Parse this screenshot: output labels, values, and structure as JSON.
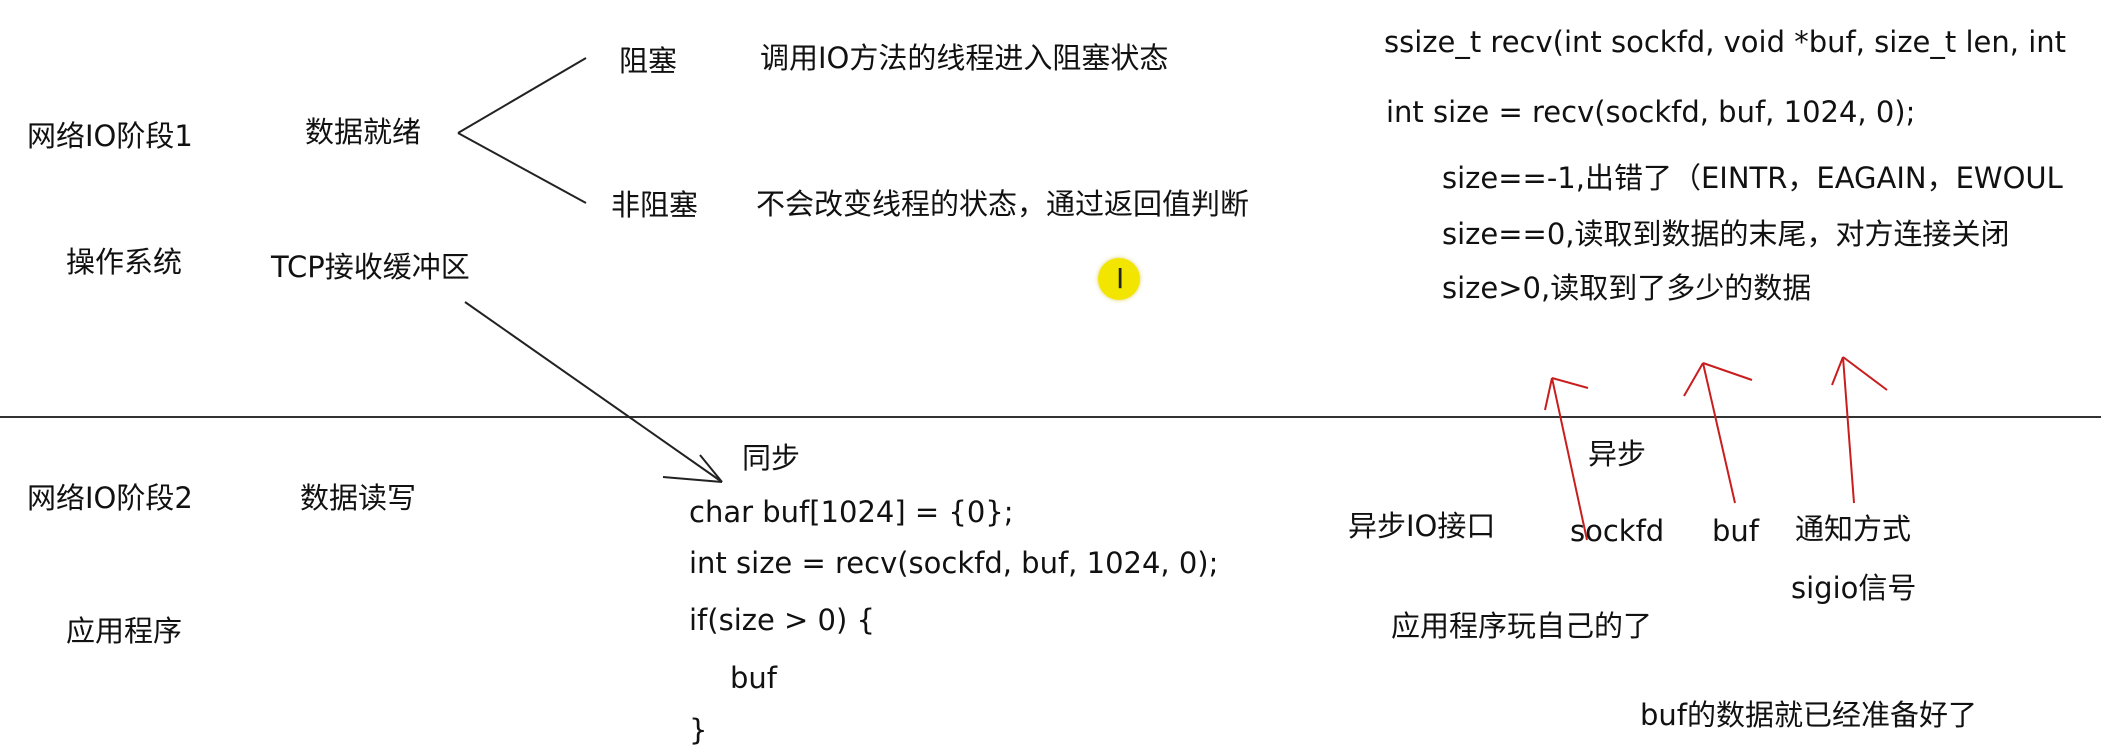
{
  "stage1": {
    "label": "网络IO阶段1",
    "sub_label": "操作系统",
    "data_ready": "数据就绪",
    "tcp_buffer": "TCP接收缓冲区",
    "blocking": {
      "label": "阻塞",
      "desc": "调用IO方法的线程进入阻塞状态"
    },
    "non_blocking": {
      "label": "非阻塞",
      "desc": "不会改变线程的状态，通过返回值判断"
    }
  },
  "recv_info": {
    "signature": "ssize_t recv(int sockfd, void *buf, size_t len, int",
    "call": "int size = recv(sockfd, buf, 1024, 0);",
    "cases": [
      "size==-1,出错了（EINTR，EAGAIN，EWOUL",
      "size==0,读取到数据的末尾，对方连接关闭",
      "size>0,读取到了多少的数据"
    ]
  },
  "stage2": {
    "label": "网络IO阶段2",
    "sub_label": "应用程序",
    "data_rw": "数据读写",
    "sync_label": "同步",
    "code": [
      "char buf[1024] = {0};",
      "int size = recv(sockfd, buf, 1024, 0);",
      "if(size > 0) {",
      "buf",
      "}"
    ]
  },
  "async": {
    "label": "异步",
    "interface": "异步IO接口",
    "params": [
      "sockfd",
      "buf",
      "通知方式"
    ],
    "signal": "sigio信号",
    "app_note": "应用程序玩自己的了",
    "ready_note": "buf的数据就已经准备好了"
  },
  "colors": {
    "ink": "#111111",
    "annotation_arrow": "#c81e1e",
    "divider": "#333333",
    "cursor_highlight": "#f2e600"
  },
  "icons": {
    "cursor": "text-cursor-icon"
  }
}
